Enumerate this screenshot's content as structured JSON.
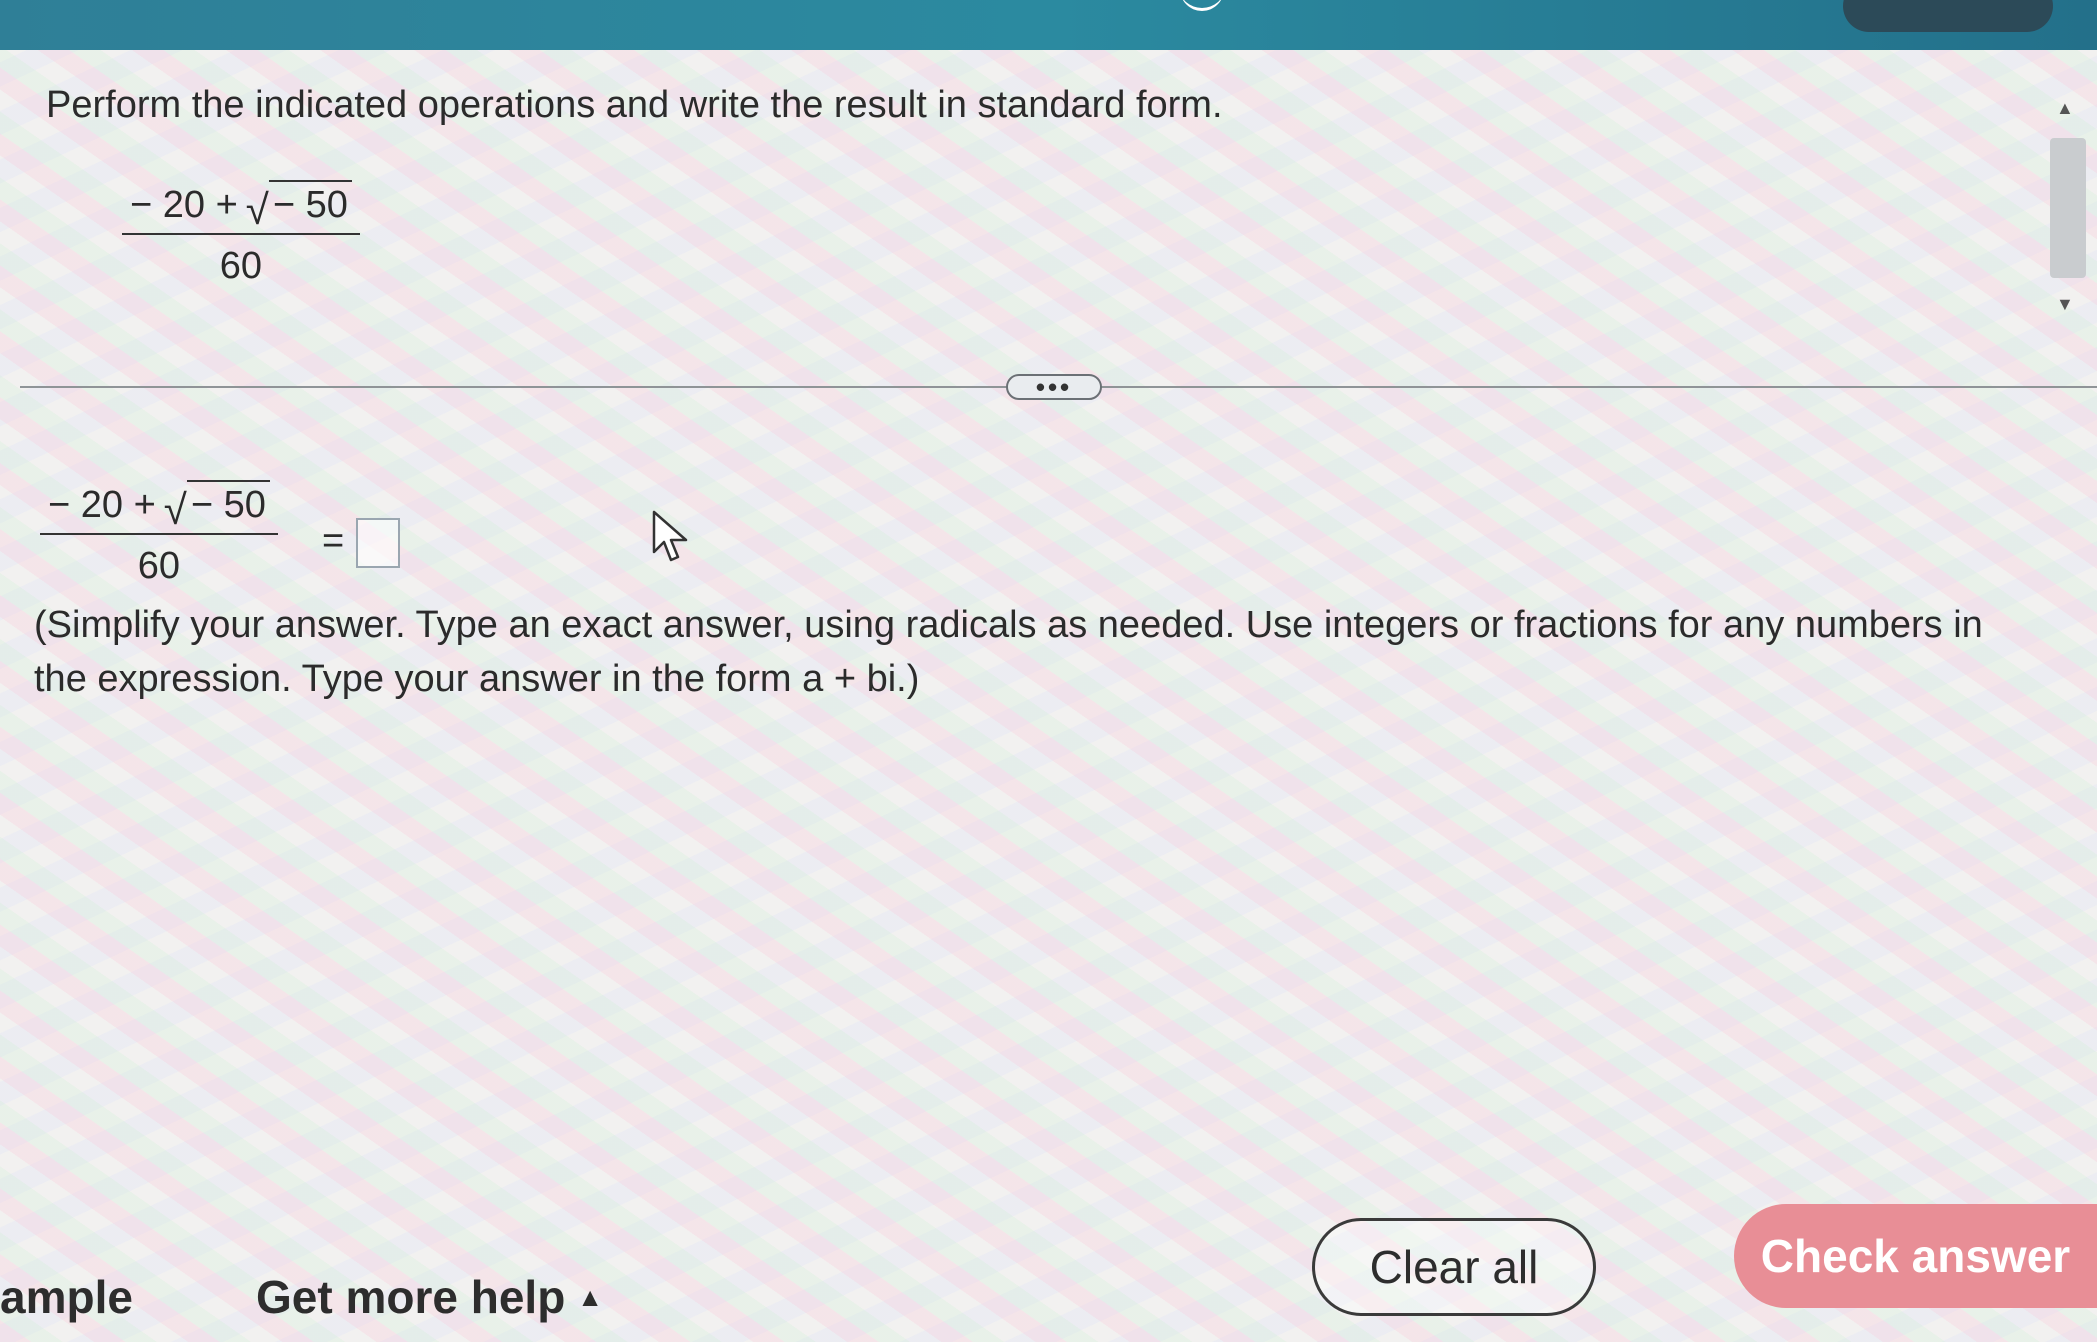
{
  "question": {
    "instruction": "Perform the indicated operations and write the result in standard form.",
    "expression": {
      "numerator_lead": "− 20 +",
      "radicand": "− 50",
      "denominator": "60"
    }
  },
  "answer": {
    "equals": "=",
    "help_text": "(Simplify your answer. Type an exact answer, using radicals as needed. Use integers or fractions for any numbers in the expression. Type your answer in the form a + bi.)"
  },
  "divider": {
    "expand_label": "•••"
  },
  "footer": {
    "example_label": "ample",
    "more_help_label": "Get more help",
    "clear_all_label": "Clear all",
    "check_answer_label": "Check answer"
  },
  "colors": {
    "header": "#2b8aa0",
    "check_answer_bg": "#e88e96",
    "text": "#2b2b2b"
  }
}
